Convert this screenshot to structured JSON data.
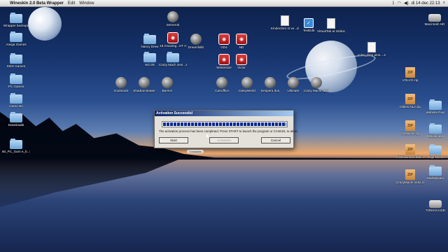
{
  "menubar": {
    "app_name": "Wineskin 2.0 Beta Wrapper",
    "menus": [
      "Edit",
      "Window"
    ],
    "clock": "di 14 dec  22:13"
  },
  "desktop_icons": [
    {
      "label": "Wrapper backups",
      "kind": "folder"
    },
    {
      "label": "Amiga Games",
      "kind": "folder"
    },
    {
      "label": "MSX Games",
      "kind": "folder"
    },
    {
      "label": "PC Games",
      "kind": "folder"
    },
    {
      "label": "Game Bo",
      "kind": "folder"
    },
    {
      "label": "Downloads",
      "kind": "folder"
    },
    {
      "label": "50_PC_Gam e_b...yber",
      "kind": "folder"
    },
    {
      "label": "Semerok",
      "kind": "circle"
    },
    {
      "label": "Nancy Drew",
      "kind": "folder"
    },
    {
      "label": "18 Amazing...HT II",
      "kind": "red"
    },
    {
      "label": "Dreamfall2",
      "kind": "circle"
    },
    {
      "label": "Wii Ok",
      "kind": "folder"
    },
    {
      "label": "Crazy Mach ines...zim",
      "kind": "folder"
    },
    {
      "label": "GD4",
      "kind": "red"
    },
    {
      "label": "ND",
      "kind": "red"
    },
    {
      "label": "Wintersize",
      "kind": "red"
    },
    {
      "label": "Victor",
      "kind": "red"
    },
    {
      "label": "Godmod3",
      "kind": "circle"
    },
    {
      "label": "Shadow Beater",
      "kind": "circle"
    },
    {
      "label": "Barrien",
      "kind": "circle"
    },
    {
      "label": "Carroffice",
      "kind": "circle"
    },
    {
      "label": "DaisyWorld",
      "kind": "circle"
    },
    {
      "label": "Despera dos",
      "kind": "circle"
    },
    {
      "label": "Ultimatrr",
      "kind": "circle"
    },
    {
      "label": "Crazy Machi nes2",
      "kind": "circle"
    },
    {
      "label": "Kinderdom st ve...doc",
      "kind": "doc"
    },
    {
      "label": "TextEdit",
      "kind": "check"
    },
    {
      "label": "VirtualTak at 16/doc",
      "kind": "doc"
    },
    {
      "label": "volvo_theg ame....exe",
      "kind": "doc"
    },
    {
      "label": "Macintosh HD",
      "kind": "drive"
    },
    {
      "label": "VOLVO.zip",
      "kind": "zip"
    },
    {
      "label": "Oldies.NL2.zip",
      "kind": "zip"
    },
    {
      "label": "Website Paul",
      "kind": "folder"
    },
    {
      "label": "Cossacks.zip",
      "kind": "zip"
    },
    {
      "label": "Moviecube",
      "kind": "folder"
    },
    {
      "label": "GGDownloa dMa...r.zip",
      "kind": "zip"
    },
    {
      "label": "Mijn Docs",
      "kind": "folder"
    },
    {
      "label": "Marktplaats",
      "kind": "folder"
    },
    {
      "label": "CrazyMachi nes2.zip",
      "kind": "zip"
    },
    {
      "label": "TONIAS HDD",
      "kind": "drive"
    }
  ],
  "dialog": {
    "title": "Activation Successful",
    "progress": 1.0,
    "message": "The activation process has been completed. Press START to launch the program or CANCEL to abort.",
    "buttons": {
      "start": "Start",
      "activate": "Activation",
      "cancel": "Cancel"
    }
  },
  "task_pill": "Cossacks",
  "colors": {
    "dialog_bg": "#e4e1da",
    "titlebar": "#0a246a",
    "progress": "#0a2a8c"
  }
}
